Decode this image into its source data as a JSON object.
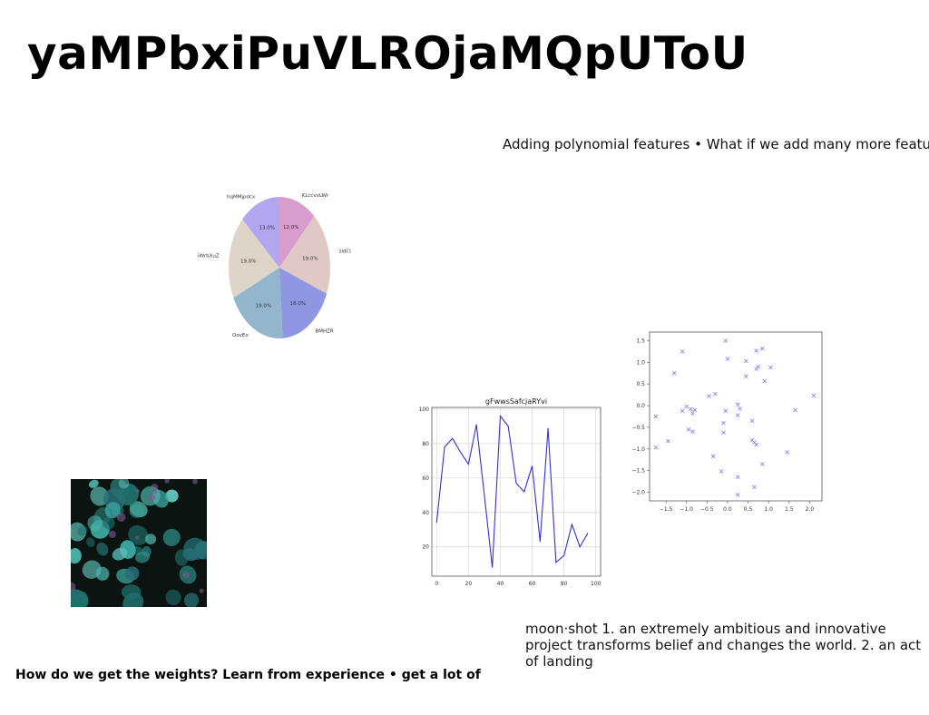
{
  "page": {
    "title": "yaMPbxiPuVLROjaMQpUToU",
    "subtitle_right": "Adding polynomial features • What if we add many more features",
    "moonshot_text": "moon·shot 1. an extremely ambitious and innovative project transforms belief and changes the world. 2. an act of landing",
    "bottom_left_text": "How do we get the weights? Learn from experience • get a lot of"
  },
  "colors": {
    "photo_bg": "#0b1411",
    "leaf": "#2e8c86"
  },
  "chart_data": [
    {
      "type": "pie",
      "labels": [
        "KLccvvLWr",
        "sidCl",
        "BMHZR",
        "OovEo",
        "SWrbXuZ",
        "hqMMjpdcx"
      ],
      "values": [
        12.0,
        19.0,
        18.0,
        19.0,
        19.0,
        13.0
      ],
      "value_labels": [
        "12.0%",
        "19.0%",
        "18.0%",
        "19.0%",
        "19.0%",
        "13.0%"
      ],
      "colors": [
        "#d89dcc",
        "#e0c8c6",
        "#8f97e3",
        "#93b6cc",
        "#ddd5c8",
        "#b1a6ef"
      ],
      "start_angle": 90,
      "direction": "clockwise"
    },
    {
      "type": "line",
      "title": "gFwwsSafcjaRYvi",
      "x": [
        0,
        5,
        10,
        15,
        20,
        25,
        30,
        35,
        40,
        45,
        50,
        55,
        60,
        65,
        70,
        75,
        80,
        85,
        90,
        95,
        100
      ],
      "y": [
        34,
        78,
        83,
        75,
        68,
        91,
        50,
        8,
        96,
        90,
        57,
        52,
        67,
        23,
        89,
        11,
        15,
        33,
        20,
        28
      ],
      "x_ticks": [
        0,
        20,
        40,
        60,
        80,
        100
      ],
      "y_ticks": [
        20,
        40,
        60,
        80,
        100
      ],
      "xlim": [
        -3,
        103
      ],
      "ylim": [
        3,
        101
      ],
      "color": "#3333cc",
      "grid": true
    },
    {
      "type": "scatter",
      "x_ticks": [
        -1.5,
        -1.0,
        -0.5,
        0.0,
        0.5,
        1.0,
        1.5,
        2.0
      ],
      "y_ticks": [
        1.5,
        1.0,
        0.5,
        0.0,
        -0.5,
        -1.0,
        -1.5,
        -2.0
      ],
      "xlim": [
        -1.9,
        2.3
      ],
      "ylim": [
        -2.2,
        1.7
      ],
      "marker": "x",
      "color": "#8e86e6",
      "points": [
        [
          -0.05,
          1.5
        ],
        [
          0.85,
          1.32
        ],
        [
          0.7,
          1.27
        ],
        [
          -1.1,
          1.25
        ],
        [
          0.45,
          1.03
        ],
        [
          0.0,
          1.08
        ],
        [
          0.75,
          0.9
        ],
        [
          1.05,
          0.88
        ],
        [
          0.7,
          0.85
        ],
        [
          -1.3,
          0.75
        ],
        [
          0.45,
          0.68
        ],
        [
          0.9,
          0.57
        ],
        [
          -0.3,
          0.27
        ],
        [
          -0.45,
          0.22
        ],
        [
          0.25,
          0.03
        ],
        [
          2.1,
          0.23
        ],
        [
          -1.0,
          -0.02
        ],
        [
          0.3,
          -0.07
        ],
        [
          -0.9,
          -0.08
        ],
        [
          -0.8,
          -0.1
        ],
        [
          1.65,
          -0.1
        ],
        [
          -1.1,
          -0.12
        ],
        [
          -0.05,
          -0.12
        ],
        [
          -0.85,
          -0.18
        ],
        [
          0.25,
          -0.22
        ],
        [
          -1.75,
          -0.25
        ],
        [
          0.6,
          -0.35
        ],
        [
          -0.1,
          -0.4
        ],
        [
          -0.95,
          -0.55
        ],
        [
          -0.85,
          -0.6
        ],
        [
          -0.1,
          -0.62
        ],
        [
          -1.45,
          -0.82
        ],
        [
          0.6,
          -0.8
        ],
        [
          0.65,
          -0.85
        ],
        [
          0.7,
          -0.9
        ],
        [
          -1.75,
          -0.97
        ],
        [
          1.45,
          -1.08
        ],
        [
          -0.35,
          -1.17
        ],
        [
          0.85,
          -1.35
        ],
        [
          -0.15,
          -1.52
        ],
        [
          0.25,
          -1.65
        ],
        [
          0.65,
          -1.88
        ],
        [
          0.25,
          -2.06
        ]
      ]
    }
  ]
}
